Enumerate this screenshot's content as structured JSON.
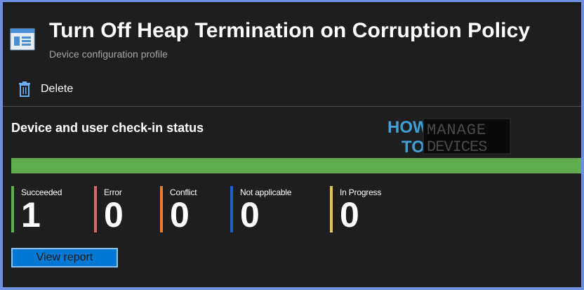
{
  "header": {
    "title": "Turn Off Heap Termination on Corruption Policy",
    "subtitle": "Device configuration profile",
    "icon": "configuration-profile-icon"
  },
  "toolbar": {
    "delete_label": "Delete",
    "delete_icon": "trash-icon"
  },
  "checkin": {
    "section_title": "Device and user check-in status",
    "bar_color": "#5fad4e",
    "succeeded_fraction": 1.0,
    "stats": [
      {
        "label": "Succeeded",
        "value": "1",
        "color": "#5fad4e"
      },
      {
        "label": "Error",
        "value": "0",
        "color": "#d9686a"
      },
      {
        "label": "Conflict",
        "value": "0",
        "color": "#f07d2b"
      },
      {
        "label": "Not applicable",
        "value": "0",
        "color": "#1f5fd0"
      },
      {
        "label": "In Progress",
        "value": "0",
        "color": "#e2c64e"
      }
    ],
    "view_report_label": "View report"
  },
  "watermark": {
    "word_how": "HOW",
    "word_to": "TO",
    "word_manage": "MANAGE",
    "word_devices": "DEVICES"
  },
  "colors": {
    "accent": "#0078d4",
    "background": "#1e1e1e",
    "outer_border": "#6f8fe0"
  }
}
